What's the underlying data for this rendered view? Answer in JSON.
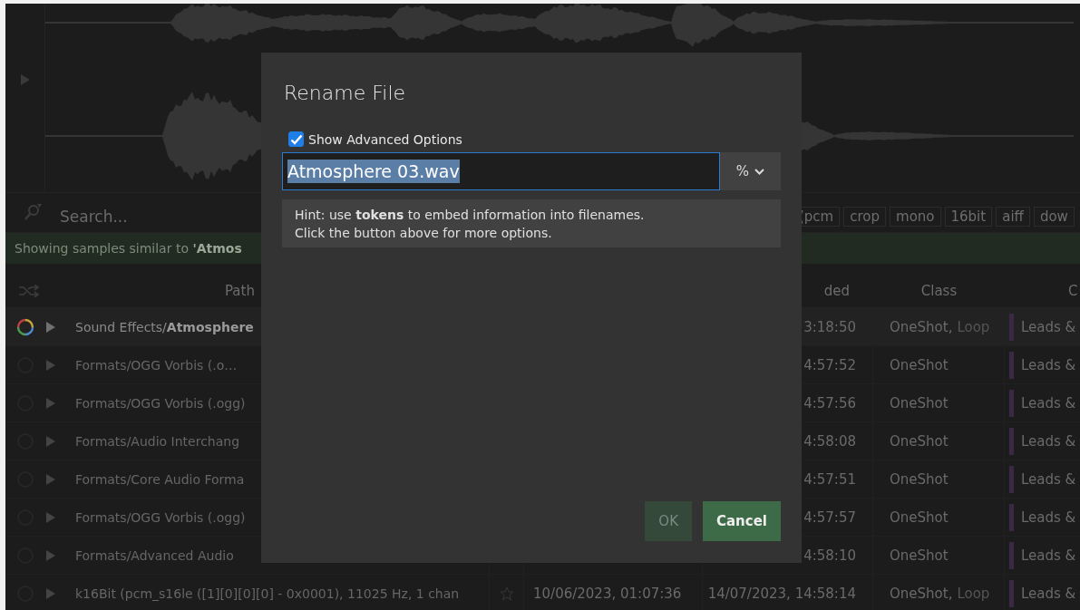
{
  "search": {
    "placeholder": "Search..."
  },
  "tags": [
    "(pcm",
    "crop",
    "mono",
    "16bit",
    "aiff",
    "dow"
  ],
  "info_bar": {
    "text": "Showing samples similar to **'Atmos**"
  },
  "table": {
    "columns": [
      {
        "label": "Path"
      },
      {
        "label": "ded"
      },
      {
        "label": "Class"
      },
      {
        "label": "C"
      }
    ],
    "rows": [
      {
        "selected": true,
        "path": "Sound Effects/**Atmosphere**",
        "modified": "3:18:50",
        "class": "OneShot,",
        "class_dim": "Loop",
        "category": "Leads &"
      },
      {
        "selected": false,
        "path": "Formats/OGG Vorbis (.o…",
        "modified": "4:57:52",
        "class": "OneShot",
        "category": "Leads &"
      },
      {
        "selected": false,
        "path": "Formats/OGG Vorbis (.ogg)",
        "modified": "4:57:56",
        "class": "OneShot",
        "category": "Leads &"
      },
      {
        "selected": false,
        "path": "Formats/Audio Interchang",
        "modified": "4:58:08",
        "class": "OneShot",
        "category": "Leads &"
      },
      {
        "selected": false,
        "path": "Formats/Core Audio Forma",
        "modified": "4:57:51",
        "class": "OneShot",
        "category": "Leads &"
      },
      {
        "selected": false,
        "path": "Formats/OGG Vorbis (.ogg)",
        "modified": "4:57:57",
        "class": "OneShot",
        "category": "Leads &"
      },
      {
        "selected": false,
        "path": "Formats/Advanced Audio",
        "modified": "4:58:10",
        "class": "OneShot",
        "category": "Leads &"
      },
      {
        "selected": false,
        "path": "k16Bit (pcm_s16le ([1][0][0][0] - 0x0001), 11025 Hz, 1 chan",
        "starred": false,
        "added": "10/06/2023, 01:07:36",
        "modified": "14/07/2023, 14:58:14",
        "class": "OneShot,",
        "class_dim": "Loop",
        "category": "Leads &"
      }
    ]
  },
  "dialog": {
    "title": "Rename File",
    "checkbox": {
      "label": "Show Advanced Options",
      "checked": true
    },
    "filename": {
      "value": "Atmosphere 03.wav",
      "selected": true
    },
    "token_button": {
      "label": "%"
    },
    "hint": [
      "Hint: use **tokens** to embed information into filenames.",
      "Click the button above for more options."
    ],
    "buttons": [
      {
        "label": "OK",
        "disabled": true
      },
      {
        "label": "Cancel",
        "disabled": false
      }
    ]
  }
}
